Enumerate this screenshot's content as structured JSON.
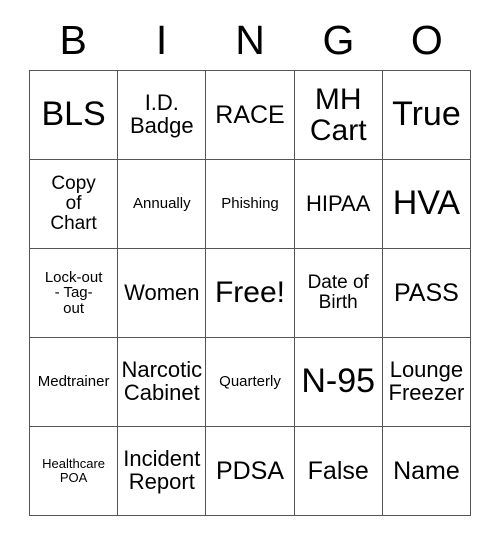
{
  "card": {
    "header_letters": [
      "B",
      "I",
      "N",
      "G",
      "O"
    ],
    "rows": [
      [
        {
          "text": "BLS",
          "size": "fs-xxl"
        },
        {
          "text": "I.D.\nBadge",
          "size": "fs-md"
        },
        {
          "text": "RACE",
          "size": "fs-lg"
        },
        {
          "text": "MH\nCart",
          "size": "fs-xl"
        },
        {
          "text": "True",
          "size": "fs-xxl"
        }
      ],
      [
        {
          "text": "Copy\nof\nChart",
          "size": "fs-sm"
        },
        {
          "text": "Annually",
          "size": "fs-xs"
        },
        {
          "text": "Phishing",
          "size": "fs-xs"
        },
        {
          "text": "HIPAA",
          "size": "fs-md"
        },
        {
          "text": "HVA",
          "size": "fs-xxl"
        }
      ],
      [
        {
          "text": "Lock-out\n- Tag-\nout",
          "size": "fs-xs"
        },
        {
          "text": "Women",
          "size": "fs-md"
        },
        {
          "text": "Free!",
          "size": "fs-xl"
        },
        {
          "text": "Date of\nBirth",
          "size": "fs-sm"
        },
        {
          "text": "PASS",
          "size": "fs-lg"
        }
      ],
      [
        {
          "text": "Medtrainer",
          "size": "fs-xs"
        },
        {
          "text": "Narcotic\nCabinet",
          "size": "fs-md"
        },
        {
          "text": "Quarterly",
          "size": "fs-xs"
        },
        {
          "text": "N-95",
          "size": "fs-xxl"
        },
        {
          "text": "Lounge\nFreezer",
          "size": "fs-md"
        }
      ],
      [
        {
          "text": "Healthcare\nPOA",
          "size": "fs-xxs"
        },
        {
          "text": "Incident\nReport",
          "size": "fs-md"
        },
        {
          "text": "PDSA",
          "size": "fs-lg"
        },
        {
          "text": "False",
          "size": "fs-lg"
        },
        {
          "text": "Name",
          "size": "fs-lg"
        }
      ]
    ],
    "colors": {
      "border": "#555555",
      "text": "#000000",
      "background": "#ffffff"
    }
  }
}
